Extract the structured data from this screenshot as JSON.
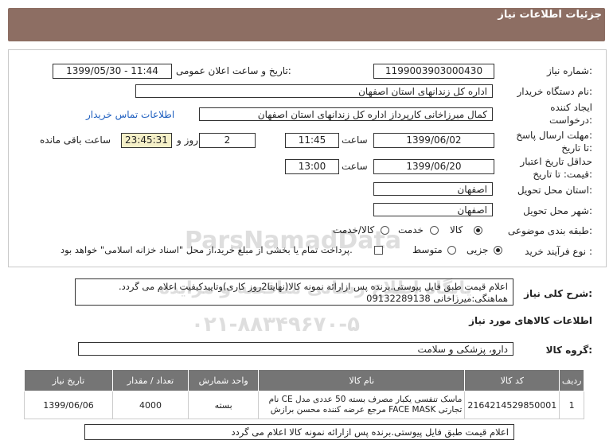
{
  "header": {
    "title": "جزئیات اطلاعات نیاز"
  },
  "form": {
    "need_number_label": "شماره نیاز:",
    "need_number": "1199003903000430",
    "announce_label": "تاریخ و ساعت اعلان عمومی:",
    "announce_value": "1399/05/30 - 11:44",
    "buyer_org_label": "نام دستگاه خریدار:",
    "buyer_org": "اداره کل زندانهای استان اصفهان",
    "creator_label_1": "ایجاد کننده",
    "creator_label_2": "درخواست:",
    "creator": "کمال میرزاخانی کارپرداز اداره کل زندانهای استان اصفهان",
    "contact_link": "اطلاعات تماس خریدار",
    "deadline_label_1": "مهلت ارسال پاسخ:",
    "deadline_label_2": "تا تاریخ:",
    "deadline_date": "1399/06/02",
    "time_label": "ساعت",
    "deadline_time": "11:45",
    "days_value": "2",
    "days_label": "روز و",
    "remaining_time": "23:45:31",
    "remaining_label": "ساعت باقی مانده",
    "validity_label_1": "حداقل تاریخ اعتبار",
    "validity_label_2": "قیمت: تا تاریخ:",
    "validity_date": "1399/06/20",
    "validity_time": "13:00",
    "province_label": "استان محل تحویل:",
    "province": "اصفهان",
    "city_label": "شهر محل تحویل:",
    "city": "اصفهان",
    "category_label": "طبقه بندی موضوعی:",
    "category_options": [
      "کالا",
      "خدمت",
      "کالا/خدمت"
    ],
    "category_selected": "کالا",
    "process_label": "نوع فرآیند خرید :",
    "process_options": [
      "جزیی",
      "متوسط"
    ],
    "process_selected": "جزیی",
    "payment_note": "پرداخت تمام یا بخشی از مبلغ خرید،از محل \"اسناد خزانه اسلامی\" خواهد بود."
  },
  "description": {
    "label": "شرح کلی نیاز:",
    "text": "اعلام قیمت طبق فایل پیوستی.برنده پس ازارائه نمونه کالا(نهایتا2روز کاری)وتاییدکیفیت اعلام می گردد. هماهنگی:میرزاخانی 09132289138"
  },
  "goods": {
    "section_title": "اطلاعات کالاهای مورد نیاز",
    "group_label": "گروه کالا:",
    "group_value": "دارو، پزشکی و سلامت",
    "columns": [
      "ردیف",
      "کد کالا",
      "نام کالا",
      "واحد شمارش",
      "تعداد / مقدار",
      "تاریخ نیاز"
    ],
    "rows": [
      {
        "index": "1",
        "code": "2164214529850001",
        "name": "ماسک تنفسی یکبار مصرف بسته 50 عددی مدل CE نام تجارتی FACE MASK مرجع عرضه کننده محسن برازش",
        "unit": "بسته",
        "quantity": "4000",
        "date": "1399/06/06"
      }
    ]
  },
  "bottom_text": "اعلام قیمت طبق فایل پیوستی.برنده پس ازارائه نمونه کالا اعلام می گردد",
  "watermark": {
    "line1": "ParsNamadData",
    "line2": "پایگاه اطلاع رسانی مناقصه و مزایده",
    "line3": "۰۲۱-۸۸۳۴۹۶۷۰-۵"
  }
}
